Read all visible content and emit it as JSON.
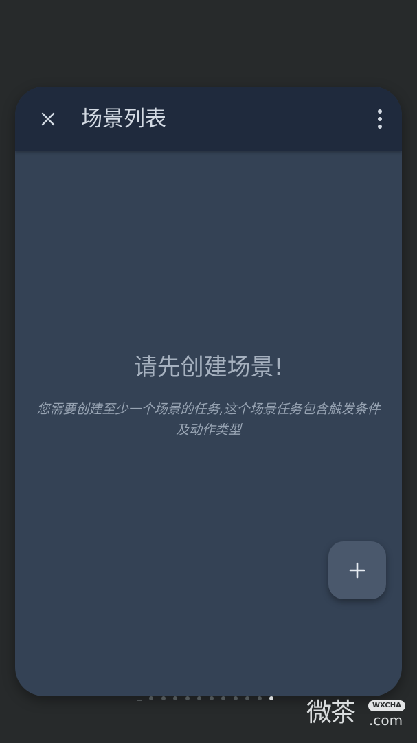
{
  "header": {
    "title": "场景列表",
    "close_icon": "close-icon",
    "more_icon": "more-vertical-icon"
  },
  "empty_state": {
    "title": "请先创建场景!",
    "description": "您需要创建至少一个场景的任务,这个场景任务包含触发条件及动作类型"
  },
  "fab": {
    "icon": "plus-icon"
  },
  "page_indicator": {
    "count": 11,
    "active_index": 10
  },
  "watermark": {
    "cn": "微茶",
    "badge": "WXCHA",
    "com": ".com"
  },
  "colors": {
    "page_background": "#272a2b",
    "card_background": "#344255",
    "header_background": "#1f2a3d",
    "fab_background": "#4a586c",
    "primary_text": "#d3dae3"
  }
}
